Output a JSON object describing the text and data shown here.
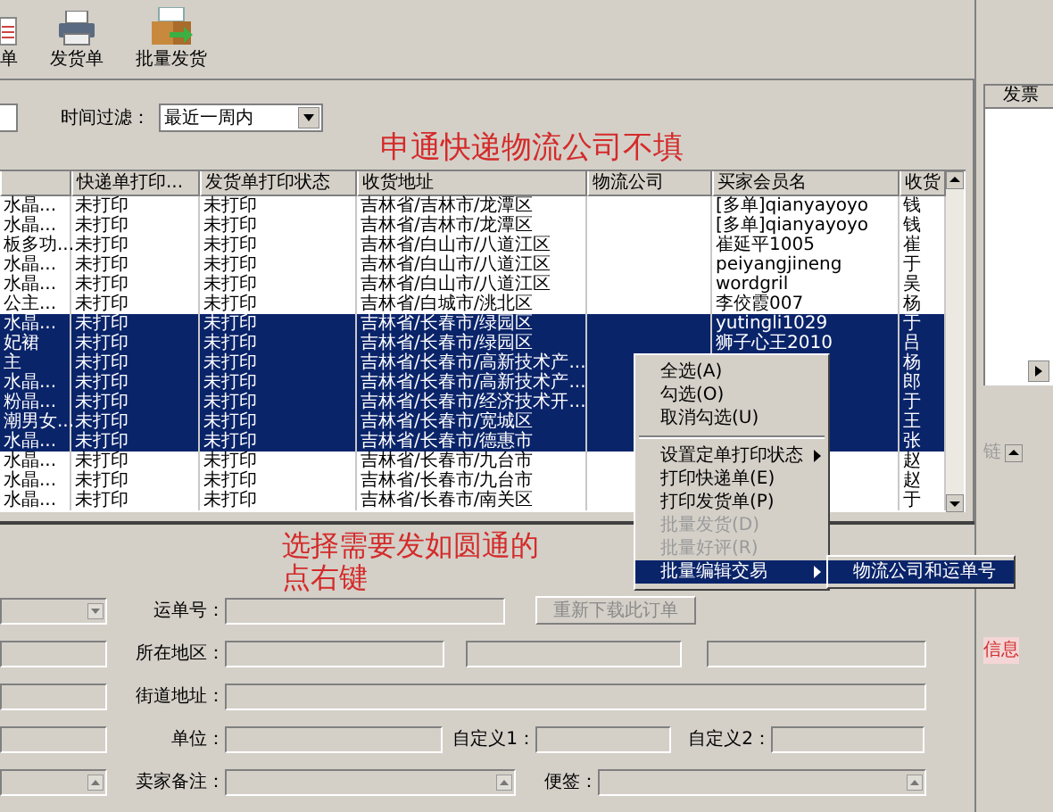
{
  "toolbar": [
    {
      "label": "单",
      "kind": "document"
    },
    {
      "label": "发货单",
      "kind": "printer"
    },
    {
      "label": "批量发货",
      "kind": "box"
    }
  ],
  "filter": {
    "label": "时间过滤：",
    "value": "最近一周内"
  },
  "table": {
    "columns": [
      "快递单打印...",
      "发货单打印状态",
      "收货地址",
      "物流公司",
      "买家会员名",
      "收货"
    ],
    "rows": [
      {
        "c0": "水晶...",
        "express": "未打印",
        "invoice": "未打印",
        "address": "吉林省/吉林市/龙潭区",
        "buyer": "[多单]qianyayoyo",
        "receiver": "钱",
        "selected": false
      },
      {
        "c0": "水晶...",
        "express": "未打印",
        "invoice": "未打印",
        "address": "吉林省/吉林市/龙潭区",
        "buyer": "[多单]qianyayoyo",
        "receiver": "钱",
        "selected": false
      },
      {
        "c0": "板多功...",
        "express": "未打印",
        "invoice": "未打印",
        "address": "吉林省/白山市/八道江区",
        "buyer": "崔延平1005",
        "receiver": "崔",
        "selected": false
      },
      {
        "c0": "水晶...",
        "express": "未打印",
        "invoice": "未打印",
        "address": "吉林省/白山市/八道江区",
        "buyer": "peiyangjineng",
        "receiver": "于",
        "selected": false
      },
      {
        "c0": "水晶...",
        "express": "未打印",
        "invoice": "未打印",
        "address": "吉林省/白山市/八道江区",
        "buyer": "wordgril",
        "receiver": "吴",
        "selected": false
      },
      {
        "c0": "公主...",
        "express": "未打印",
        "invoice": "未打印",
        "address": "吉林省/白城市/洮北区",
        "buyer": "李佼霞007",
        "receiver": "杨",
        "selected": false
      },
      {
        "c0": "水晶...",
        "express": "未打印",
        "invoice": "未打印",
        "address": "吉林省/长春市/绿园区",
        "buyer": "yutingli1029",
        "receiver": "于",
        "selected": true
      },
      {
        "c0": "妃裙",
        "express": "未打印",
        "invoice": "未打印",
        "address": "吉林省/长春市/绿园区",
        "buyer": "狮子心王2010",
        "receiver": "吕",
        "selected": true
      },
      {
        "c0": "主",
        "express": "未打印",
        "invoice": "未打印",
        "address": "吉林省/长春市/高新技术产...",
        "receiver": "杨",
        "selected": true
      },
      {
        "c0": "水晶...",
        "express": "未打印",
        "invoice": "未打印",
        "address": "吉林省/长春市/高新技术产...",
        "receiver": "郎",
        "selected": true
      },
      {
        "c0": "粉晶...",
        "express": "未打印",
        "invoice": "未打印",
        "address": "吉林省/长春市/经济技术开...",
        "receiver": "于",
        "selected": true
      },
      {
        "c0": "潮男女...",
        "express": "未打印",
        "invoice": "未打印",
        "address": "吉林省/长春市/宽城区",
        "receiver": "王",
        "selected": true
      },
      {
        "c0": "水晶...",
        "express": "未打印",
        "invoice": "未打印",
        "address": "吉林省/长春市/德惠市",
        "receiver": "张",
        "selected": true
      },
      {
        "c0": "水晶...",
        "express": "未打印",
        "invoice": "未打印",
        "address": "吉林省/长春市/九台市",
        "receiver": "赵",
        "selected": false
      },
      {
        "c0": "水晶...",
        "express": "未打印",
        "invoice": "未打印",
        "address": "吉林省/长春市/九台市",
        "receiver": "赵",
        "selected": false
      },
      {
        "c0": "水晶...",
        "express": "未打印",
        "invoice": "未打印",
        "address": "吉林省/长春市/南关区",
        "receiver": "于",
        "selected": false
      }
    ]
  },
  "context_menu": {
    "items": [
      {
        "kind": "item",
        "label": "全选(A)",
        "disabled": false,
        "submenu": false,
        "selected": false
      },
      {
        "kind": "item",
        "label": "勾选(O)",
        "disabled": false,
        "submenu": false,
        "selected": false
      },
      {
        "kind": "item",
        "label": "取消勾选(U)",
        "disabled": false,
        "submenu": false,
        "selected": false
      },
      {
        "kind": "separator"
      },
      {
        "kind": "item",
        "label": "设置定单打印状态",
        "disabled": false,
        "submenu": true,
        "selected": false
      },
      {
        "kind": "item",
        "label": "打印快递单(E)",
        "disabled": false,
        "submenu": false,
        "selected": false
      },
      {
        "kind": "item",
        "label": "打印发货单(P)",
        "disabled": false,
        "submenu": false,
        "selected": false
      },
      {
        "kind": "item",
        "label": "批量发货(D)",
        "disabled": true,
        "submenu": false,
        "selected": false
      },
      {
        "kind": "item",
        "label": "批量好评(R)",
        "disabled": true,
        "submenu": false,
        "selected": false
      },
      {
        "kind": "item",
        "label": "批量编辑交易",
        "disabled": false,
        "submenu": true,
        "selected": true
      }
    ]
  },
  "submenu": {
    "items": [
      {
        "label": "物流公司和运单号",
        "selected": true
      }
    ]
  },
  "form": {
    "waybill_label": "运单号：",
    "redownload_button": "重新下载此订单",
    "region_label": "所在地区：",
    "street_label": "街道地址：",
    "unit_label": "单位：",
    "custom1_label": "自定义1：",
    "custom2_label": "自定义2：",
    "seller_note_label": "卖家备注：",
    "memo_label": "便签："
  },
  "right_panel": {
    "column": "发票",
    "tab_label": "链",
    "info_label": "信息"
  },
  "annotations": [
    "申通快递物流公司不填",
    "选择需要发如圆通的",
    "点右键"
  ]
}
